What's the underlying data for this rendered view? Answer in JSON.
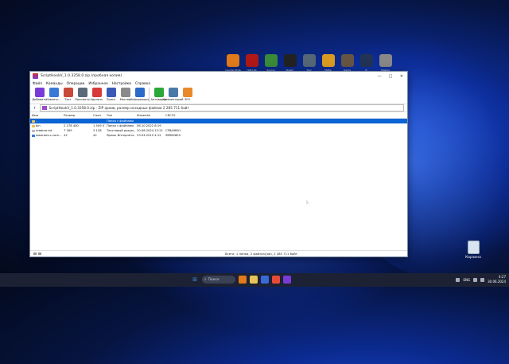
{
  "desktop": {
    "icons": [
      {
        "label": "Counter-Strike",
        "color": "#e07a1a"
      },
      {
        "label": "Half-Life",
        "color": "#b01818"
      },
      {
        "label": "Source",
        "color": "#3a8a3a"
      },
      {
        "label": "Steam",
        "color": "#222222"
      },
      {
        "label": "Tool",
        "color": "#556677"
      },
      {
        "label": "Mafia",
        "color": "#d89a20"
      },
      {
        "label": "Game",
        "color": "#665544"
      },
      {
        "label": "IV",
        "color": "#223355"
      },
      {
        "label": "Мафия",
        "color": "#888888"
      }
    ],
    "recycle_label": "Корзина"
  },
  "window": {
    "title": "ScriptHookV_1.0.3258.0.zip (пробная копия)",
    "controls": [
      "—",
      "□",
      "✕"
    ],
    "menu": [
      "Файл",
      "Команды",
      "Операции",
      "Избранное",
      "Настройки",
      "Справка"
    ],
    "toolbar": [
      {
        "label": "Добавить",
        "icon": "add-icon",
        "color": "#7a3ad8"
      },
      {
        "label": "Извлечь...",
        "icon": "extract-icon",
        "color": "#3a78d8"
      },
      {
        "label": "Тест",
        "icon": "test-icon",
        "color": "#c84a3a"
      },
      {
        "label": "Просмотр",
        "icon": "view-icon",
        "color": "#5a6a7a"
      },
      {
        "label": "Удалить",
        "icon": "delete-icon",
        "color": "#d83a3a"
      },
      {
        "label": "Поиск",
        "icon": "find-icon",
        "color": "#3a5ab8"
      },
      {
        "label": "Мастер",
        "icon": "wizard-icon",
        "color": "#8a8a8a"
      },
      {
        "label": "Информация",
        "icon": "info-icon",
        "color": "#2a6ac8"
      },
      {
        "label": "Антивирус",
        "icon": "antivirus-icon",
        "color": "#2aa83a"
      },
      {
        "label": "Комментарий",
        "icon": "comment-icon",
        "color": "#4a7aa8"
      },
      {
        "label": "SFX",
        "icon": "sfx-icon",
        "color": "#e88a2a"
      }
    ],
    "path": "ScriptHookV_1.0.3258.0.zip - ZIP архив, размер исходных файлов 2 285 711 байт",
    "columns": [
      "Имя",
      "Размер",
      "Сжат",
      "Тип",
      "Изменён",
      "CRC32"
    ],
    "rows": [
      {
        "name": "..",
        "size": "",
        "packed": "",
        "type": "Папка с файлами",
        "modified": "",
        "crc": "",
        "selected": true,
        "icon_color": "#e8c25a"
      },
      {
        "name": "bin",
        "size": "2 278 400",
        "packed": "1 509 078",
        "type": "Папка с файлами",
        "modified": "06.10.2022 8:19",
        "crc": "",
        "selected": false,
        "icon_color": "#e8c25a"
      },
      {
        "name": "readme.txt",
        "size": "7 269",
        "packed": "3 128",
        "type": "Текстовый докум...",
        "modified": "20.06.2024 12:21",
        "crc": "CFBA9B01",
        "selected": false,
        "icon_color": "#bbbbbb"
      },
      {
        "name": "www.dev-c.com...",
        "size": "42",
        "packed": "42",
        "type": "Ярлык Интернета",
        "modified": "23.04.2015 4:12",
        "crc": "9B9826E0",
        "selected": false,
        "icon_color": "#3a78d8"
      }
    ],
    "status": "Всего: 1 папка, 2 файл(а)(ов), 2 285 711 байт"
  },
  "taskbar": {
    "search_placeholder": "Поиск",
    "apps": [
      {
        "name": "start-icon",
        "color": "#3a8ad8"
      },
      {
        "name": "counterstrike-icon",
        "color": "#e07a1a"
      },
      {
        "name": "file-explorer-icon",
        "color": "#e8c25a"
      },
      {
        "name": "store-icon",
        "color": "#3a6ad8"
      },
      {
        "name": "yandex-browser-icon",
        "color": "#e84a3a"
      },
      {
        "name": "winrar-icon",
        "color": "#7a3ad8"
      }
    ],
    "lang": "ENG",
    "time": "4:27",
    "date": "30.06.2024"
  }
}
